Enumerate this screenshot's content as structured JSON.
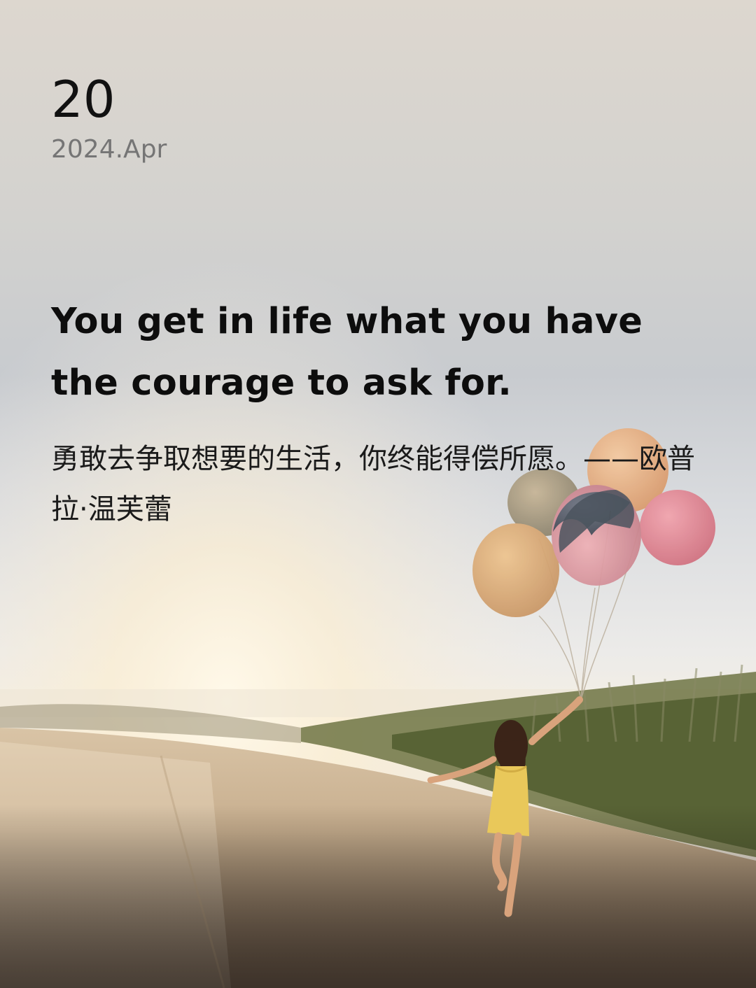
{
  "date": {
    "day": "20",
    "month_year": "2024.Apr"
  },
  "quote": {
    "english": "You get in life what you have the courage to ask for.",
    "chinese": "勇敢去争取想要的生活，你终能得偿所愿。——欧普拉·温芙蕾"
  },
  "colors": {
    "day_text": "#111111",
    "month_text": "#757575",
    "quote_text": "#0d0d0d",
    "sky_top": "#dcd7d0",
    "sky_mid": "#c8cbce",
    "sun_glow": "#fff6e0",
    "road": "#c9b8a2",
    "grass": "#5e6a3a",
    "balloon_pink": "#e38a96",
    "balloon_peach": "#e8b48a",
    "balloon_dark": "#4a5663",
    "dress": "#e9c85a"
  },
  "background": {
    "icon": "girl-with-balloons-photo"
  }
}
